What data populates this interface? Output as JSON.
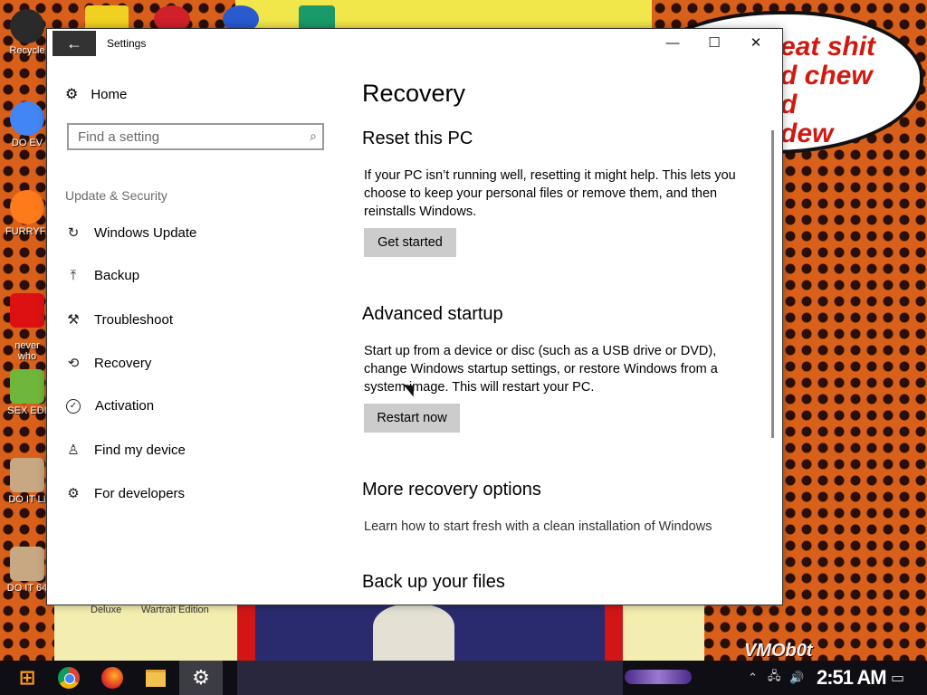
{
  "desktop": {
    "speech_text": "eat shit\nd chew\nd\ndew",
    "icons": [
      {
        "label": "Recycle",
        "color": "#2a2a2a"
      },
      {
        "label": "DO EV",
        "color": "#4285f4"
      },
      {
        "label": "FURRYFU",
        "color": "#ff7a1a"
      },
      {
        "label": "never\nwho",
        "color": "#d11"
      },
      {
        "label": "SEX EDI",
        "color": "#6fb73a"
      },
      {
        "label": "DO IT LI",
        "color": "#c8a882"
      },
      {
        "label": "DO IT 64",
        "color": "#c8a882"
      }
    ],
    "caption_left": "Deluxe",
    "caption_right": "Wartrait Edition",
    "watermark": "VMOb0t"
  },
  "window": {
    "title": "Settings",
    "back_icon": "←",
    "min_icon": "—",
    "max_icon": "☐",
    "close_icon": "✕"
  },
  "sidebar": {
    "home_label": "Home",
    "search_placeholder": "Find a setting",
    "group_title": "Update & Security",
    "items": [
      {
        "label": "Windows Update",
        "icon": "↻"
      },
      {
        "label": "Backup",
        "icon": "⤒"
      },
      {
        "label": "Troubleshoot",
        "icon": "⚒"
      },
      {
        "label": "Recovery",
        "icon": "⟲"
      },
      {
        "label": "Activation",
        "icon": "✓"
      },
      {
        "label": "Find my device",
        "icon": "♙"
      },
      {
        "label": "For developers",
        "icon": "⚙"
      }
    ]
  },
  "content": {
    "page_title": "Recovery",
    "reset": {
      "heading": "Reset this PC",
      "text": "If your PC isn’t running well, resetting it might help. This lets you choose to keep your personal files or remove them, and then reinstalls Windows.",
      "button": "Get started"
    },
    "advanced": {
      "heading": "Advanced startup",
      "text": "Start up from a device or disc (such as a USB drive or DVD), change Windows startup settings, or restore Windows from a system image. This will restart your PC.",
      "button": "Restart now"
    },
    "more": {
      "heading": "More recovery options",
      "link": "Learn how to start fresh with a clean installation of Windows"
    },
    "backup": {
      "heading": "Back up your files"
    }
  },
  "taskbar": {
    "clock": "2:51 AM"
  }
}
